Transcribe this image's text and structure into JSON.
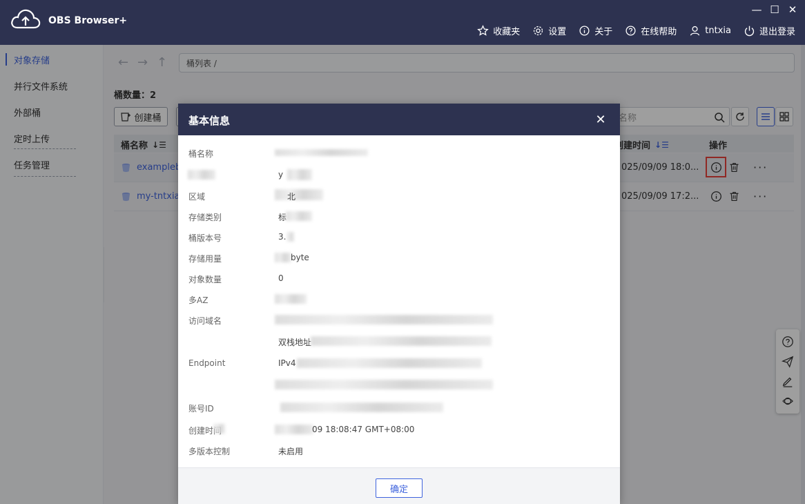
{
  "app": {
    "title": "OBS Browser+"
  },
  "window_controls": {
    "minimize": "—",
    "maximize": "☐",
    "close": "✕"
  },
  "topnav": {
    "favorites": "收藏夹",
    "settings": "设置",
    "about": "关于",
    "help": "在线帮助",
    "user": "tntxia",
    "logout": "退出登录"
  },
  "sidebar": {
    "items": [
      {
        "label": "对象存储"
      },
      {
        "label": "并行文件系统"
      },
      {
        "label": "外部桶"
      },
      {
        "label": "定时上传"
      },
      {
        "label": "任务管理"
      }
    ]
  },
  "main": {
    "path": "桶列表 /",
    "bucket_count_label": "桶数量：2",
    "create_bucket": "创建桶",
    "search_placeholder": "名称",
    "table": {
      "col_name": "桶名称",
      "col_created": "创建时间",
      "col_ops": "操作",
      "rows": [
        {
          "name": "examplebu",
          "created": "025/09/09 18:0..."
        },
        {
          "name": "my-tntxia-",
          "created": "025/09/09 17:2..."
        }
      ]
    }
  },
  "modal": {
    "title": "基本信息",
    "labels": {
      "bucket_name": "桶名称",
      "bucket_type": "桶类型",
      "region": "区域",
      "storage_class": "存储类别",
      "version": "桶版本号",
      "usage": "存储用量",
      "object_count": "对象数量",
      "multi_az": "多AZ",
      "access_domain": "访问域名",
      "endpoint": "Endpoint",
      "account_id": "账号ID",
      "created_time": "创建时间",
      "versioning": "多版本控制"
    },
    "values": {
      "bucket_type_partial": "y",
      "region_partial": "北",
      "storage_class_partial": "标",
      "version_partial": "3.",
      "usage_partial": "byte",
      "object_count_partial": "0",
      "dual_stack_partial": "双栈地址",
      "endpoint_partial": "IPv4",
      "created_time_partial": "09 18:08:47 GMT+08:00",
      "versioning": "未启用"
    },
    "ok": "确定"
  }
}
